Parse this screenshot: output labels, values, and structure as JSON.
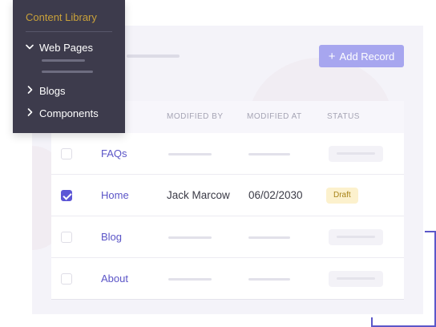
{
  "sidebar": {
    "title": "Content Library",
    "items": [
      {
        "label": "Web Pages",
        "chevron": "chevron-down-icon",
        "expanded": true
      },
      {
        "label": "Blogs",
        "chevron": "chevron-right-icon",
        "expanded": false
      },
      {
        "label": "Components",
        "chevron": "chevron-right-icon",
        "expanded": false
      }
    ]
  },
  "toolbar": {
    "add_label": "Add Record",
    "add_icon": "plus-icon"
  },
  "table": {
    "headers": [
      "MODIFIED BY",
      "MODIFIED AT",
      "STATUS"
    ],
    "rows": [
      {
        "name": "FAQs",
        "checked": false
      },
      {
        "name": "Home",
        "checked": true,
        "modified_by": "Jack Marcow",
        "modified_at": "06/02/2030",
        "status": "Draft"
      },
      {
        "name": "Blog",
        "checked": false
      },
      {
        "name": "About",
        "checked": false
      }
    ]
  },
  "colors": {
    "accent": "#5c56d6",
    "button": "#a7a6ef",
    "sidebar_bg": "#3d3b4c",
    "sidebar_title": "#c9a13a",
    "draft_badge_bg": "#fcf1cd",
    "draft_badge_text": "#a88419"
  }
}
